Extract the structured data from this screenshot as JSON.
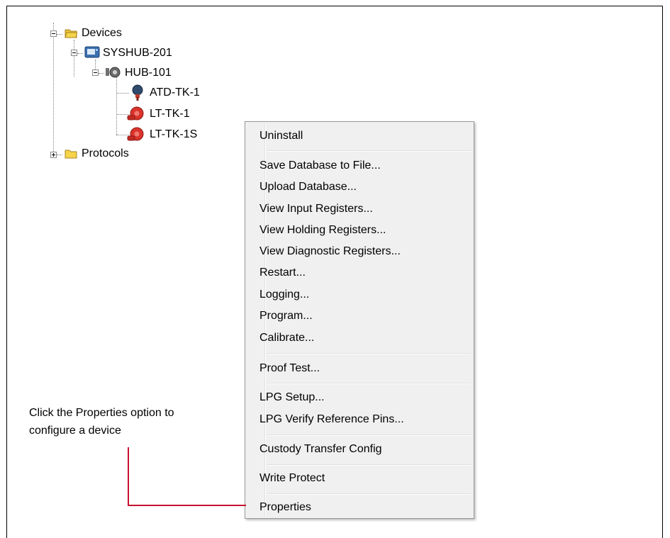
{
  "tree": {
    "devices": "Devices",
    "syshub": "SYSHUB-201",
    "hub": "HUB-101",
    "atd": "ATD-TK-1",
    "lt1": "LT-TK-1",
    "lt1s": "LT-TK-1S",
    "protocols": "Protocols"
  },
  "menu": {
    "items": [
      "Uninstall",
      "Save Database to File...",
      "Upload Database...",
      "View Input Registers...",
      "View Holding Registers...",
      "View Diagnostic Registers...",
      "Restart...",
      "Logging...",
      "Program...",
      "Calibrate...",
      "Proof Test...",
      "LPG Setup...",
      "LPG Verify Reference Pins...",
      "Custody Transfer Config",
      "Write Protect",
      "Properties"
    ]
  },
  "callout": {
    "line1": "Click the Properties option to",
    "line2": "configure a device"
  },
  "colors": {
    "callout_line": "#c8102e",
    "folder": "#f5d44a",
    "device_red": "#d9332b"
  },
  "icons": {
    "folder": "folder-icon",
    "syshub": "system-hub-icon",
    "hub": "hub-icon",
    "atd": "atd-device-icon",
    "lt": "level-transmitter-icon"
  }
}
